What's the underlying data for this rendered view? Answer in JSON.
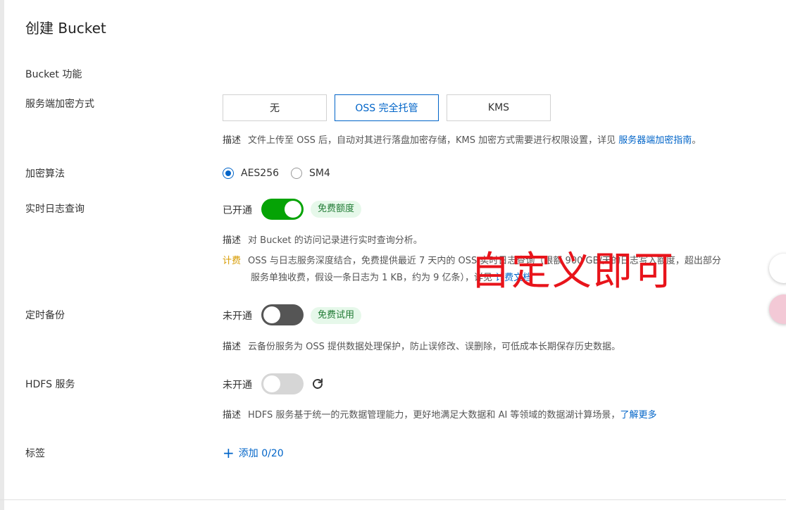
{
  "title": "创建 Bucket",
  "section_title": "Bucket 功能",
  "encryption": {
    "label": "服务端加密方式",
    "options": [
      "无",
      "OSS 完全托管",
      "KMS"
    ],
    "selected": "OSS 完全托管",
    "desc_key": "描述",
    "desc_text": "文件上传至 OSS 后，自动对其进行落盘加密存储，KMS 加密方式需要进行权限设置，详见",
    "desc_link": "服务器端加密指南",
    "desc_end": "。"
  },
  "algorithm": {
    "label": "加密算法",
    "options": [
      "AES256",
      "SM4"
    ],
    "selected": "AES256"
  },
  "realtime_log": {
    "label": "实时日志查询",
    "state_text": "已开通",
    "enabled": true,
    "tag": "免费额度",
    "desc_key": "描述",
    "desc_text": "对 Bucket 的访问记录进行实时查询分析。",
    "fee_key": "计费",
    "fee_line1": "OSS 与日志服务深度结合，免费提供最近 7 天内的 OSS 实时日志查询（限额 900 GB/天的日志写入额度，超出部分",
    "fee_line2": "服务单独收费，假设一条日志为 1 KB，约为 9 亿条），详见",
    "fee_link": "计费文档"
  },
  "backup": {
    "label": "定时备份",
    "state_text": "未开通",
    "enabled": false,
    "tag": "免费试用",
    "desc_key": "描述",
    "desc_text": "云备份服务为 OSS 提供数据处理保护，防止误修改、误删除，可低成本长期保存历史数据。"
  },
  "hdfs": {
    "label": "HDFS 服务",
    "state_text": "未开通",
    "enabled": false,
    "desc_key": "描述",
    "desc_text": "HDFS 服务基于统一的元数据管理能力，更好地满足大数据和 AI 等领域的数据湖计算场景，",
    "desc_link": "了解更多"
  },
  "tags": {
    "label": "标签",
    "add_text": "添加 0/20"
  },
  "annotation": "自定义即可",
  "colors": {
    "primary": "#0064c8",
    "switch_on": "#05a305",
    "switch_off": "#555555",
    "annotation": "#e8141b",
    "fee": "#d79b00"
  }
}
